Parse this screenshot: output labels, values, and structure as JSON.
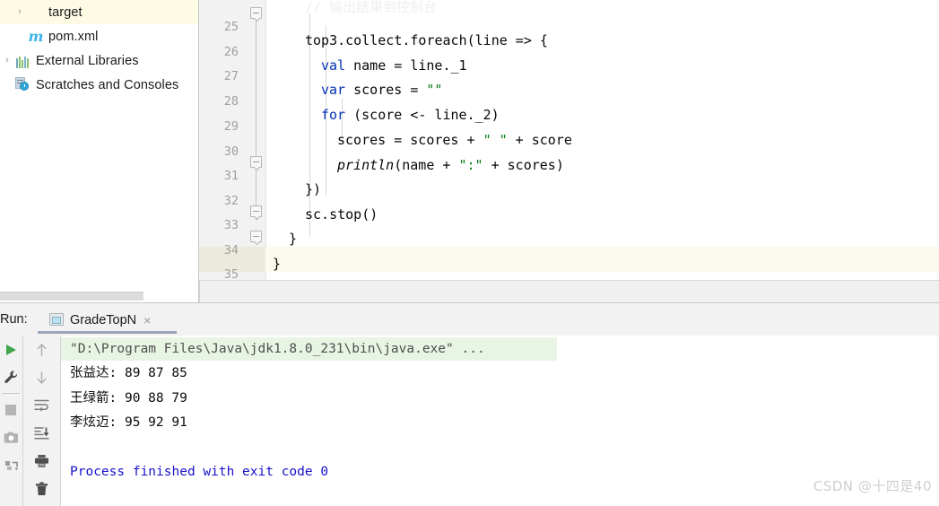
{
  "project_tree": {
    "items": [
      {
        "label": "target",
        "icon": "folder-icon",
        "arrow": "›",
        "highlight": true,
        "indent": 28
      },
      {
        "label": "pom.xml",
        "icon": "maven-icon",
        "arrow": "",
        "highlight": false,
        "indent": 28
      },
      {
        "label": "External Libraries",
        "icon": "libraries-icon",
        "arrow": "›",
        "highlight": false,
        "indent": 8
      },
      {
        "label": "Scratches and Consoles",
        "icon": "scratches-icon",
        "arrow": "",
        "highlight": false,
        "indent": 8
      }
    ]
  },
  "editor": {
    "lines": [
      {
        "num": "25",
        "text": "top3.collect.foreach(line => {"
      },
      {
        "num": "26",
        "text": "val name = line._1"
      },
      {
        "num": "27",
        "text": "var scores = \"\""
      },
      {
        "num": "28",
        "text": "for (score <- line._2)"
      },
      {
        "num": "29",
        "text": "scores = scores + \" \" + score"
      },
      {
        "num": "30",
        "text": "println(name + \":\" + scores)"
      },
      {
        "num": "31",
        "text": "})"
      },
      {
        "num": "32",
        "text": "sc.stop()"
      },
      {
        "num": "33",
        "text": "}"
      },
      {
        "num": "34",
        "text": "}"
      },
      {
        "num": "35",
        "text": ""
      }
    ],
    "current_line": "35",
    "colors": {
      "keyword": "#0033b3",
      "string": "#067d17",
      "line_number": "#a0a0a0",
      "current_line_bg": "#fcfaef"
    }
  },
  "run_window": {
    "title": "Run:",
    "tab": {
      "label": "GradeTopN",
      "close": "×",
      "icon": "run-configuration-icon"
    },
    "toolbar_left": [
      {
        "name": "rerun-button",
        "icon": "play-icon"
      },
      {
        "name": "edit-configuration-button",
        "icon": "wrench-icon"
      },
      {
        "name": "stop-button",
        "icon": "stop-icon"
      },
      {
        "name": "screenshot-button",
        "icon": "camera-icon"
      },
      {
        "name": "dump-threads-button",
        "icon": "thread-dump-icon"
      }
    ],
    "toolbar_mid": [
      {
        "name": "up-button",
        "icon": "arrow-up-icon"
      },
      {
        "name": "down-button",
        "icon": "arrow-down-icon"
      },
      {
        "name": "soft-wrap-button",
        "icon": "soft-wrap-icon"
      },
      {
        "name": "scroll-to-end-button",
        "icon": "scroll-end-icon"
      },
      {
        "name": "print-button",
        "icon": "print-icon"
      },
      {
        "name": "clear-all-button",
        "icon": "trash-icon"
      }
    ],
    "console": {
      "command_line": "\"D:\\Program Files\\Java\\jdk1.8.0_231\\bin\\java.exe\" ...",
      "output": [
        "张益达: 89 87 85",
        "王绿箭: 90 88 79",
        "李炫迈: 95 92 91"
      ],
      "finish_line": "Process finished with exit code 0",
      "highlight_color": "#e9f5e4",
      "finish_color": "#1812c9"
    }
  },
  "watermark": {
    "text": "CSDN @十四是40"
  }
}
